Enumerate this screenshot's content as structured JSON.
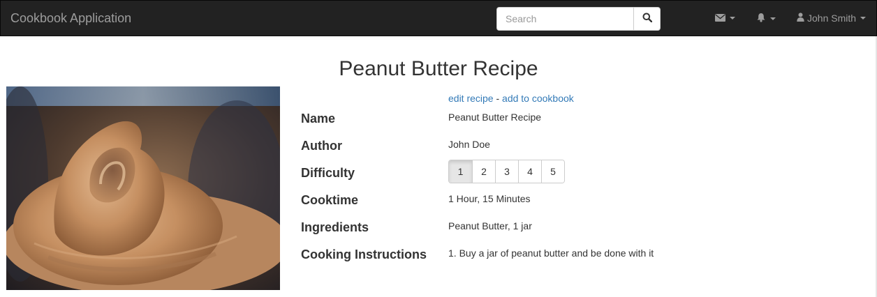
{
  "navbar": {
    "brand": "Cookbook Application",
    "search_placeholder": "Search",
    "user_name": "John Smith",
    "icons": {
      "search": "search-icon",
      "mail": "envelope-icon",
      "bell": "bell-icon",
      "user": "user-icon"
    }
  },
  "recipe": {
    "title": "Peanut Butter Recipe",
    "actions": {
      "edit": "edit recipe",
      "separator": "-",
      "add": "add to cookbook"
    },
    "fields": {
      "name": {
        "label": "Name",
        "value": "Peanut Butter Recipe"
      },
      "author": {
        "label": "Author",
        "value": "John Doe"
      },
      "difficulty": {
        "label": "Difficulty",
        "options": [
          "1",
          "2",
          "3",
          "4",
          "5"
        ],
        "selected": "1"
      },
      "cooktime": {
        "label": "Cooktime",
        "value": "1 Hour, 15 Minutes"
      },
      "ingredients": {
        "label": "Ingredients",
        "value": "Peanut Butter, 1 jar"
      },
      "instructions": {
        "label": "Cooking Instructions",
        "value": "1. Buy a jar of peanut butter and be done with it"
      }
    }
  },
  "colors": {
    "navbar_bg": "#222222",
    "navbar_text": "#9d9d9d",
    "link": "#337ab7",
    "text": "#333333"
  }
}
